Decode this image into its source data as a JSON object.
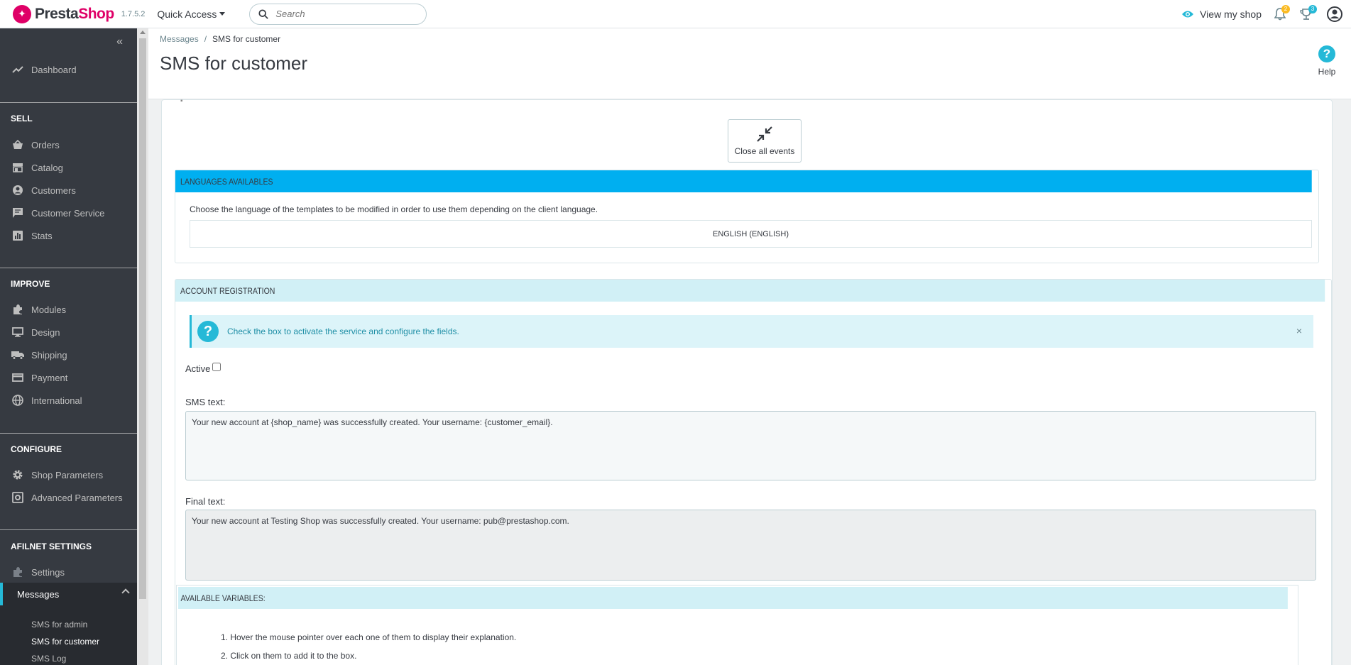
{
  "header": {
    "logo_part1": "Presta",
    "logo_part2": "Shop",
    "version": "1.7.5.2",
    "quick_access": "Quick Access",
    "search_placeholder": "Search",
    "view_shop": "View my shop",
    "notifications_count": "2",
    "trophy_count": "3"
  },
  "sidebar": {
    "dashboard": "Dashboard",
    "sell_heading": "SELL",
    "sell_items": [
      "Orders",
      "Catalog",
      "Customers",
      "Customer Service",
      "Stats"
    ],
    "improve_heading": "IMPROVE",
    "improve_items": [
      "Modules",
      "Design",
      "Shipping",
      "Payment",
      "International"
    ],
    "configure_heading": "CONFIGURE",
    "configure_items": [
      "Shop Parameters",
      "Advanced Parameters"
    ],
    "afilnet_heading": "AFILNET SETTINGS",
    "settings": "Settings",
    "messages": "Messages",
    "sub_items": [
      "SMS for admin",
      "SMS for customer",
      "SMS Log"
    ]
  },
  "page": {
    "breadcrumb_parent": "Messages",
    "breadcrumb_current": "SMS for customer",
    "title": "SMS for customer",
    "help": "Help"
  },
  "content": {
    "close_events": "Close all events",
    "languages": {
      "heading": "LANGUAGES AVAILABLES",
      "description": "Choose the language of the templates to be modified in order to use them depending on the client language.",
      "language_button": "ENGLISH (ENGLISH)"
    },
    "account": {
      "heading": "ACCOUNT REGISTRATION",
      "alert": "Check the box to activate the service and configure the fields.",
      "alert_close": "×",
      "active_label": "Active",
      "sms_text_label": "SMS text:",
      "sms_text": "Your new account at {shop_name} was successfully created. Your username: {customer_email}.",
      "final_text_label": "Final text:",
      "final_text": "Your new account at Testing Shop was successfully created. Your username: pub@prestashop.com."
    },
    "variables": {
      "heading": "AVAILABLE VARIABLES:",
      "items": [
        "1. Hover the mouse pointer over each one of them to display their explanation.",
        "2. Click on them to add it to the box."
      ]
    }
  },
  "colors": {
    "brand": "#df0067",
    "accent": "#25b9d7",
    "sidebar_bg": "#363a41",
    "section_header_blue": "#00aff0",
    "section_header_light": "#d1f0f6"
  }
}
